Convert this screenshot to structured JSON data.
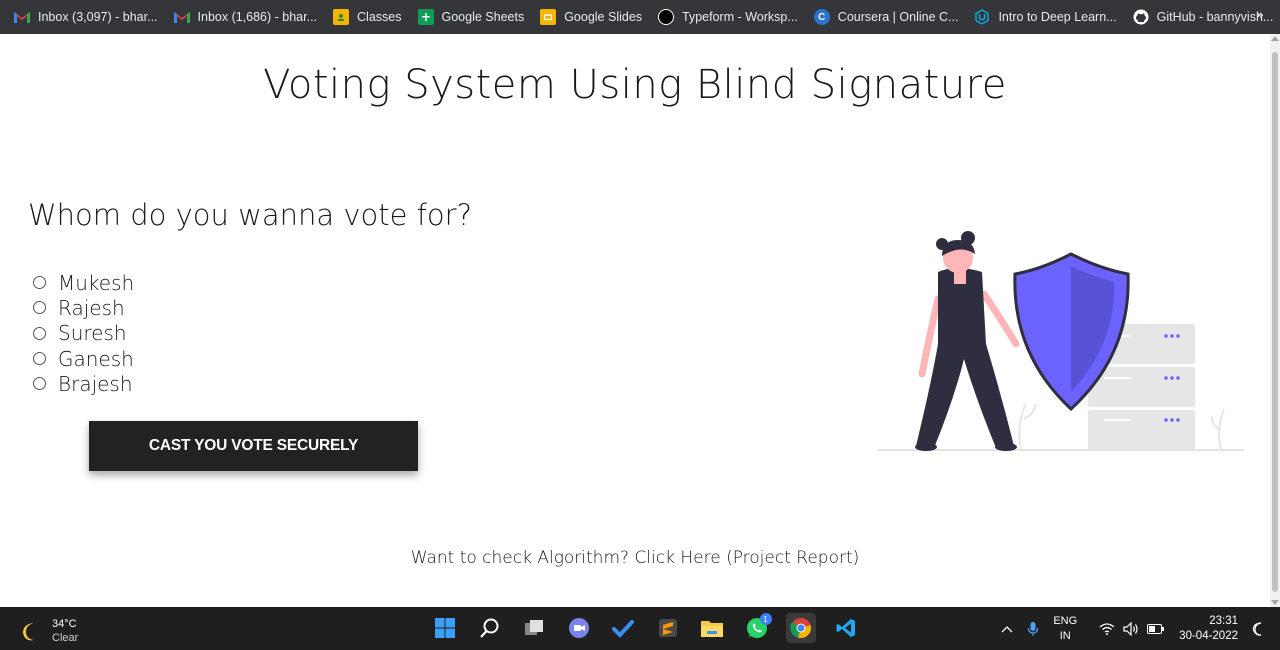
{
  "bookmarks": [
    {
      "label": "Inbox (3,097) - bhar...",
      "icon": "gmail-icon",
      "color": "#ea4335"
    },
    {
      "label": "Inbox (1,686) - bhar...",
      "icon": "gmail-icon",
      "color": "#ea4335"
    },
    {
      "label": "Classes",
      "icon": "google-classroom-icon",
      "color": "#f4b400"
    },
    {
      "label": "Google Sheets",
      "icon": "google-sheets-icon",
      "color": "#0f9d58"
    },
    {
      "label": "Google Slides",
      "icon": "google-slides-icon",
      "color": "#f4b400"
    },
    {
      "label": "Typeform - Worksp...",
      "icon": "typeform-icon",
      "color": "#000000"
    },
    {
      "label": "Coursera | Online C...",
      "icon": "coursera-icon",
      "color": "#2a73cc"
    },
    {
      "label": "Intro to Deep Learn...",
      "icon": "udacity-icon",
      "color": "#02b3e4"
    },
    {
      "label": "GitHub - bannyvish...",
      "icon": "github-icon",
      "color": "#ffffff"
    }
  ],
  "bookmarks_more": "»",
  "page": {
    "title": "Voting System Using Blind Signature",
    "question": "Whom do you wanna vote for?",
    "candidates": [
      "Mukesh",
      "Rajesh",
      "Suresh",
      "Ganesh",
      "Brajesh"
    ],
    "cast_button": "CAST YOU VOTE SECURELY",
    "footer_link": "Want to check Algorithm? Click Here (Project Report)"
  },
  "colors": {
    "button_bg": "#222222",
    "shield": "#6c63ff",
    "figure": "#2f2e41",
    "skin": "#ffb6b6"
  },
  "taskbar": {
    "weather_temp": "34°C",
    "weather_desc": "Clear",
    "apps": [
      "windows-start-icon",
      "search-icon",
      "task-view-icon",
      "chat-icon",
      "todo-icon",
      "sublime-text-icon",
      "file-explorer-icon",
      "whatsapp-icon",
      "chrome-icon",
      "vscode-icon"
    ],
    "whatsapp_badge": "1",
    "lang_top": "ENG",
    "lang_bottom": "IN",
    "time": "23:31",
    "date": "30-04-2022"
  }
}
